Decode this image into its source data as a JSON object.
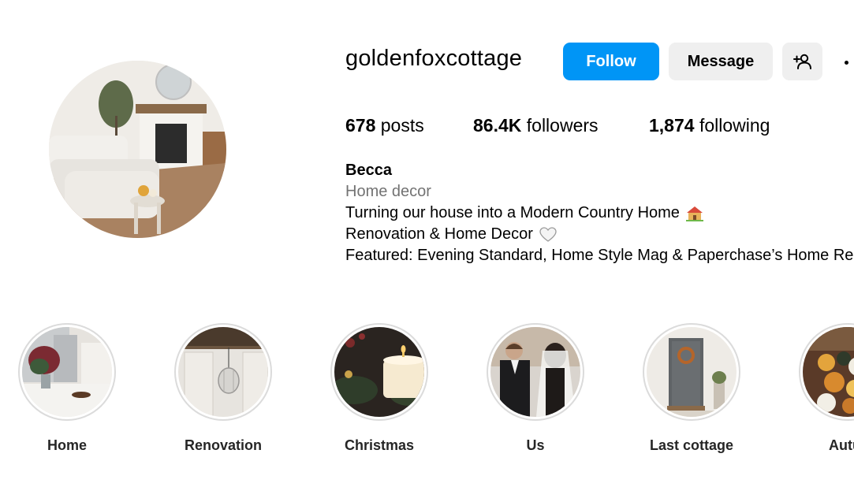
{
  "profile": {
    "username": "goldenfoxcottage",
    "buttons": {
      "follow": "Follow",
      "message": "Message"
    },
    "stats": {
      "posts_count": "678",
      "posts_label": "posts",
      "followers_count": "86.4K",
      "followers_label": "followers",
      "following_count": "1,874",
      "following_label": "following"
    },
    "bio": {
      "name": "Becca",
      "category": "Home decor",
      "line1": "Turning our house into a Modern Country Home",
      "line1_emoji": "house-emoji",
      "line2": "Renovation & Home Decor",
      "line2_emoji": "white-heart-emoji",
      "line3": "Featured: Evening Standard, Home Style Mag & Paperchase’s Home Re"
    }
  },
  "highlights": [
    {
      "label": "Home"
    },
    {
      "label": "Renovation"
    },
    {
      "label": "Christmas"
    },
    {
      "label": "Us"
    },
    {
      "label": "Last cottage"
    },
    {
      "label": "Autur"
    }
  ],
  "colors": {
    "follow_button": "#0095f6",
    "secondary_button": "#efefef",
    "category_text": "#737373",
    "highlight_ring": "#dbdbdb"
  }
}
